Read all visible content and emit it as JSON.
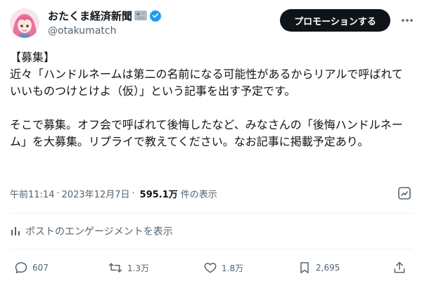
{
  "author": {
    "display_name": "おたくま経済新聞",
    "handle": "@otakumatch",
    "avatar_icon": "anime-girl-avatar",
    "badge_icon": "newspaper-icon",
    "verified_icon": "verified-badge-icon"
  },
  "header": {
    "promote_label": "プロモーションする",
    "more_icon": "more-dots-icon"
  },
  "tweet": {
    "paragraph_1": "【募集】\n近々「ハンドルネームは第二の名前になる可能性があるからリアルで呼ばれていいものつけとけよ（仮）」という記事を出す予定です。",
    "paragraph_2": "そこで募集。オフ会で呼ばれて後悔したなど、みなさんの「後悔ハンドルネーム」を大募集。リプライで教えてください。なお記事に掲載予定あり。"
  },
  "meta": {
    "time": "午前11:14",
    "separator_1": "·",
    "date": "2023年12月7日",
    "separator_2": "·",
    "views_count": "595.1万",
    "views_label": "件の表示"
  },
  "engagements": {
    "label": "ポストのエンゲージメントを表示"
  },
  "actions": {
    "reply_count": "607",
    "retweet_count": "1.3万",
    "like_count": "1.8万",
    "bookmark_count": "2,695"
  },
  "colors": {
    "text_primary": "#0f1419",
    "text_secondary": "#536471",
    "verified_blue": "#1d9bf0",
    "button_dark": "#0f1419",
    "divider": "#eff3f4"
  }
}
